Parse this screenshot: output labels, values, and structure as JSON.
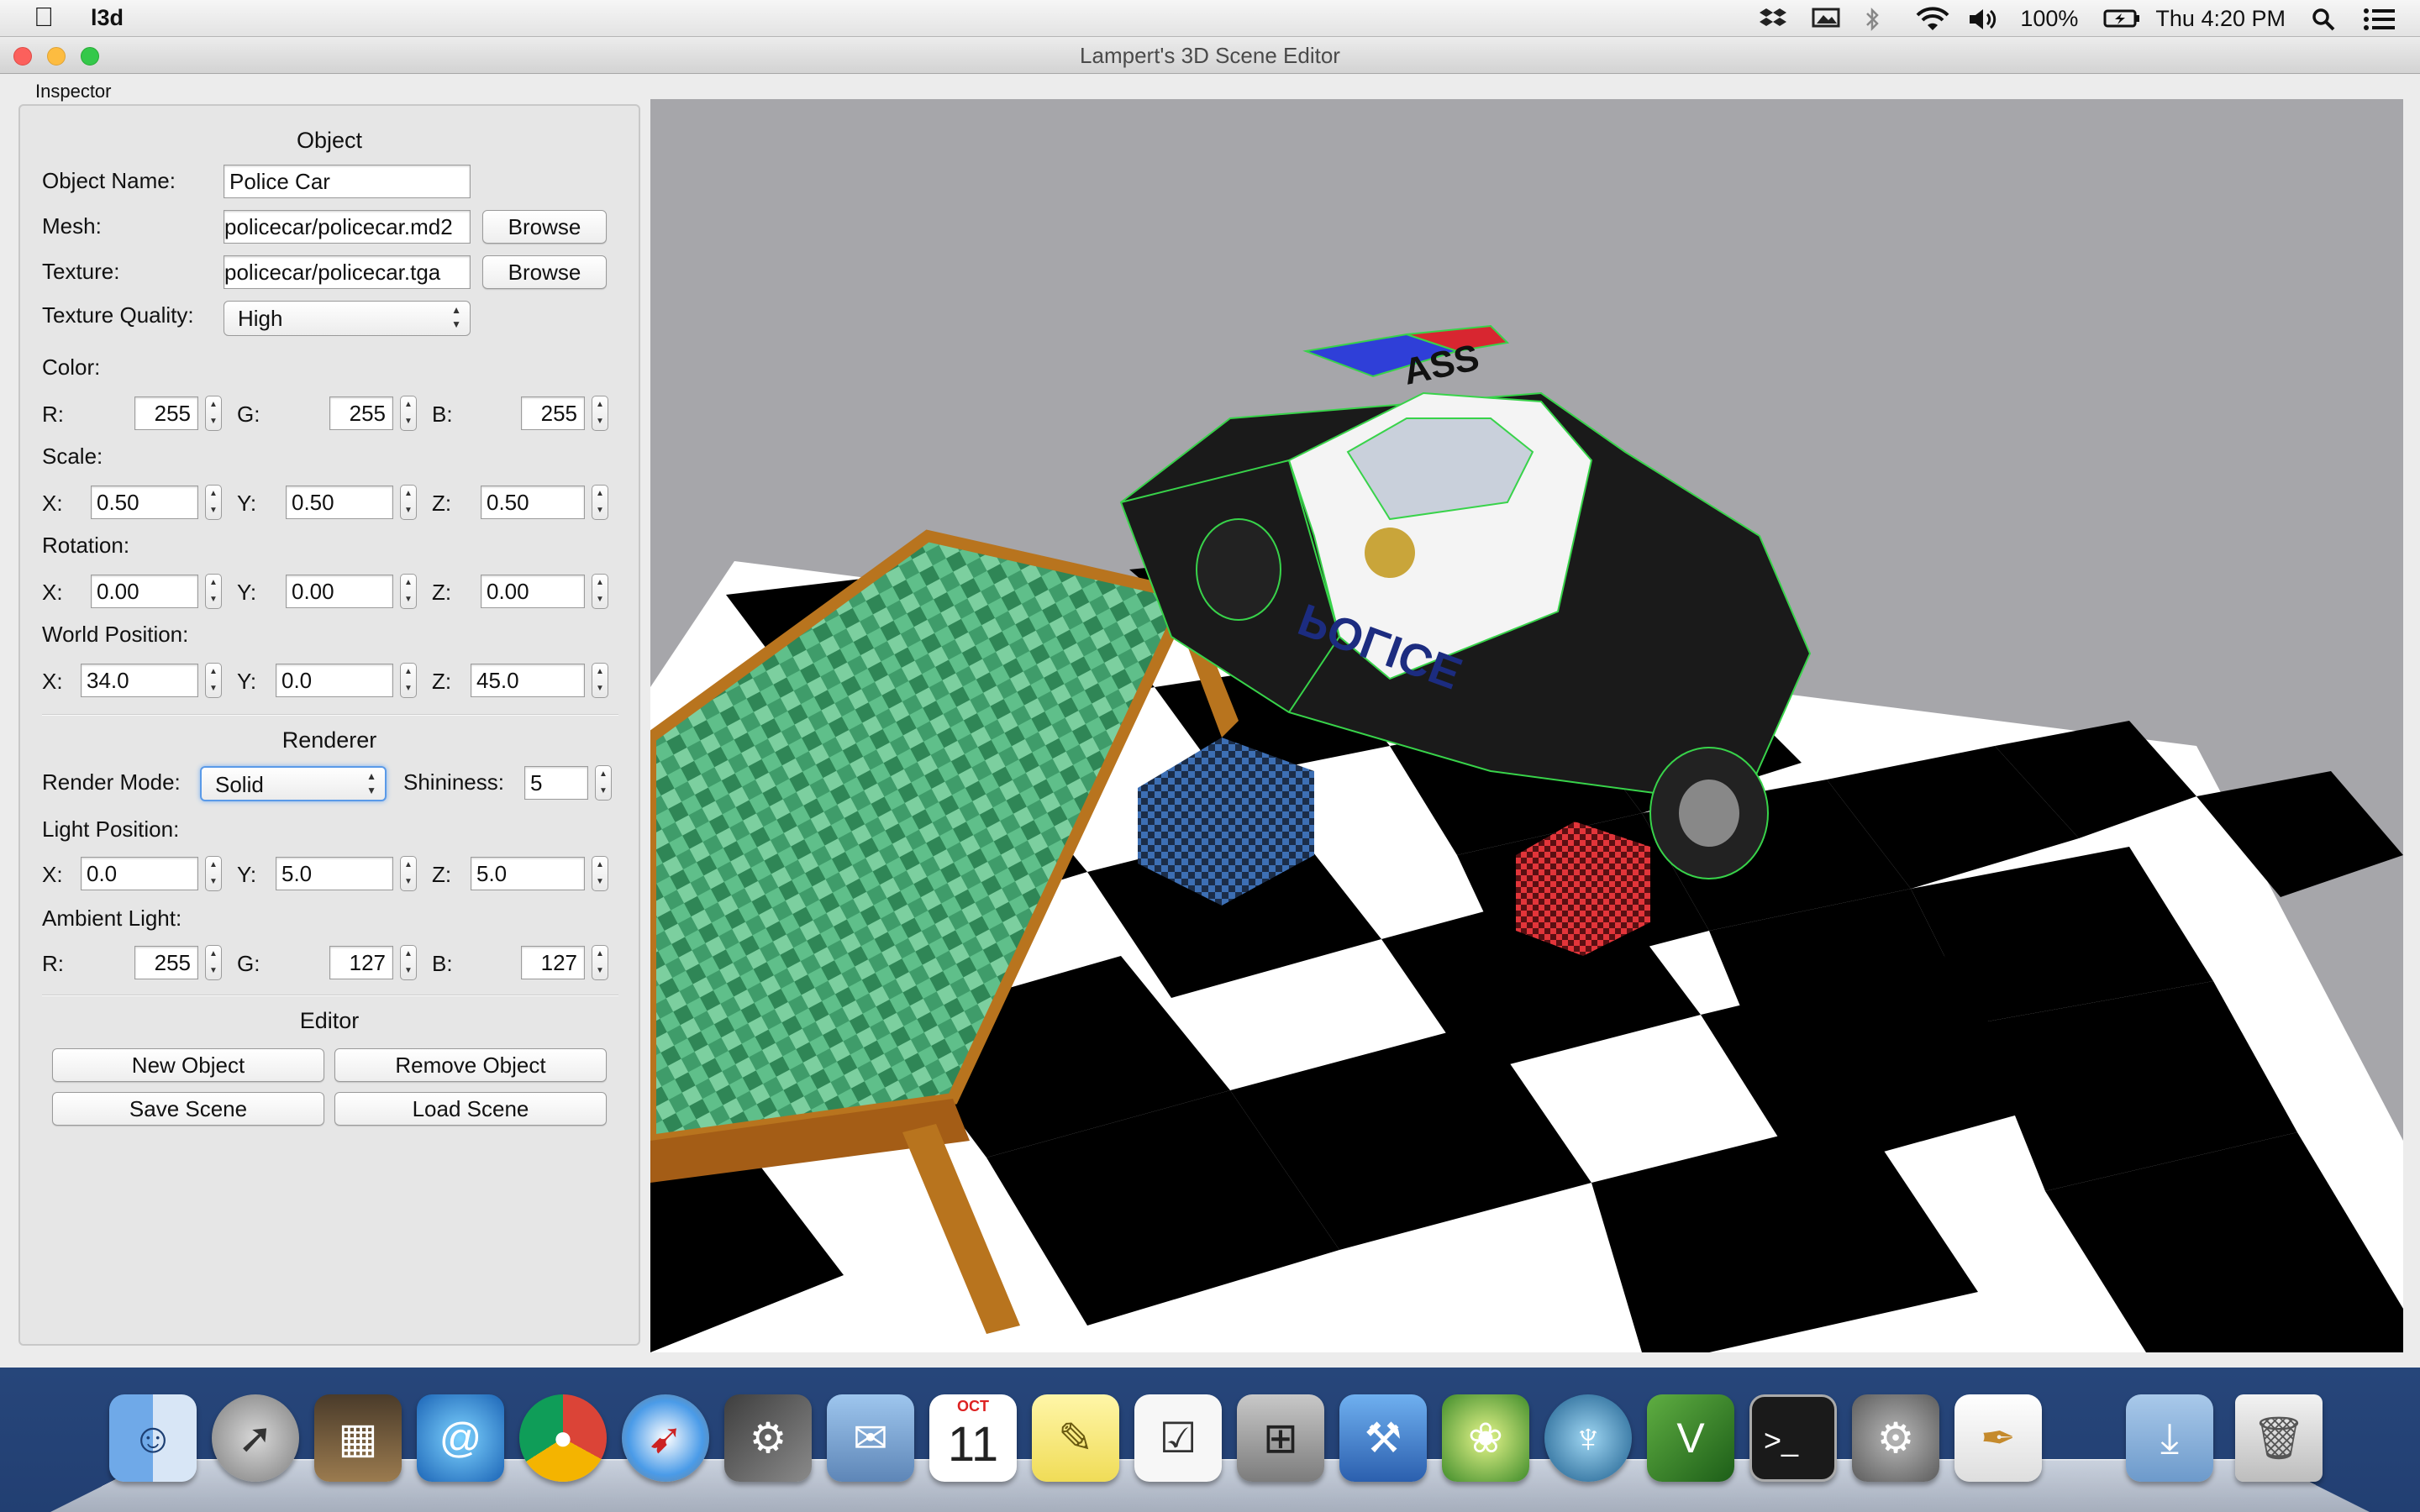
{
  "menubar": {
    "app_name": "l3d",
    "battery": "100%",
    "clock": "Thu 4:20 PM"
  },
  "window": {
    "title": "Lampert's 3D Scene Editor",
    "inspector_tab": "Inspector"
  },
  "object": {
    "section_title": "Object",
    "name_label": "Object Name:",
    "name_value": "Police Car",
    "mesh_label": "Mesh:",
    "mesh_value": "policecar/policecar.md2",
    "texture_label": "Texture:",
    "texture_value": "policecar/policecar.tga",
    "browse_label": "Browse",
    "quality_label": "Texture Quality:",
    "quality_value": "High",
    "color_label": "Color:",
    "color": {
      "r": "255",
      "g": "255",
      "b": "255"
    },
    "scale_label": "Scale:",
    "scale": {
      "x": "0.50",
      "y": "0.50",
      "z": "0.50"
    },
    "rotation_label": "Rotation:",
    "rotation": {
      "x": "0.00",
      "y": "0.00",
      "z": "0.00"
    },
    "world_position_label": "World Position:",
    "world_position": {
      "x": "34.0",
      "y": "0.0",
      "z": "45.0"
    }
  },
  "axis_labels": {
    "x": "X:",
    "y": "Y:",
    "z": "Z:",
    "r": "R:",
    "g": "G:",
    "b": "B:"
  },
  "renderer": {
    "section_title": "Renderer",
    "render_mode_label": "Render Mode:",
    "render_mode_value": "Solid",
    "shininess_label": "Shininess:",
    "shininess_value": "5",
    "light_position_label": "Light Position:",
    "light_position": {
      "x": "0.0",
      "y": "5.0",
      "z": "5.0"
    },
    "ambient_label": "Ambient Light:",
    "ambient": {
      "r": "255",
      "g": "127",
      "b": "127"
    }
  },
  "editor": {
    "section_title": "Editor",
    "new_object": "New Object",
    "remove_object": "Remove Object",
    "save_scene": "Save Scene",
    "load_scene": "Load Scene"
  },
  "scene": {
    "police_text": "POLICE",
    "roof_number": "ASS"
  },
  "calendar": {
    "month": "OCT",
    "day": "11"
  },
  "dock_items": [
    "finder-icon",
    "launchpad-icon",
    "photo-browser-icon",
    "mission-control-icon",
    "chrome-icon",
    "safari-icon",
    "steam-icon",
    "mail-icon",
    "calendar-icon",
    "stickies-icon",
    "reminders-icon",
    "calculator-icon",
    "xcode-icon",
    "app-icon",
    "sourcetree-icon",
    "vim-icon",
    "terminal-icon",
    "system-preferences-icon",
    "textedit-icon",
    "downloads-icon",
    "trash-icon"
  ]
}
